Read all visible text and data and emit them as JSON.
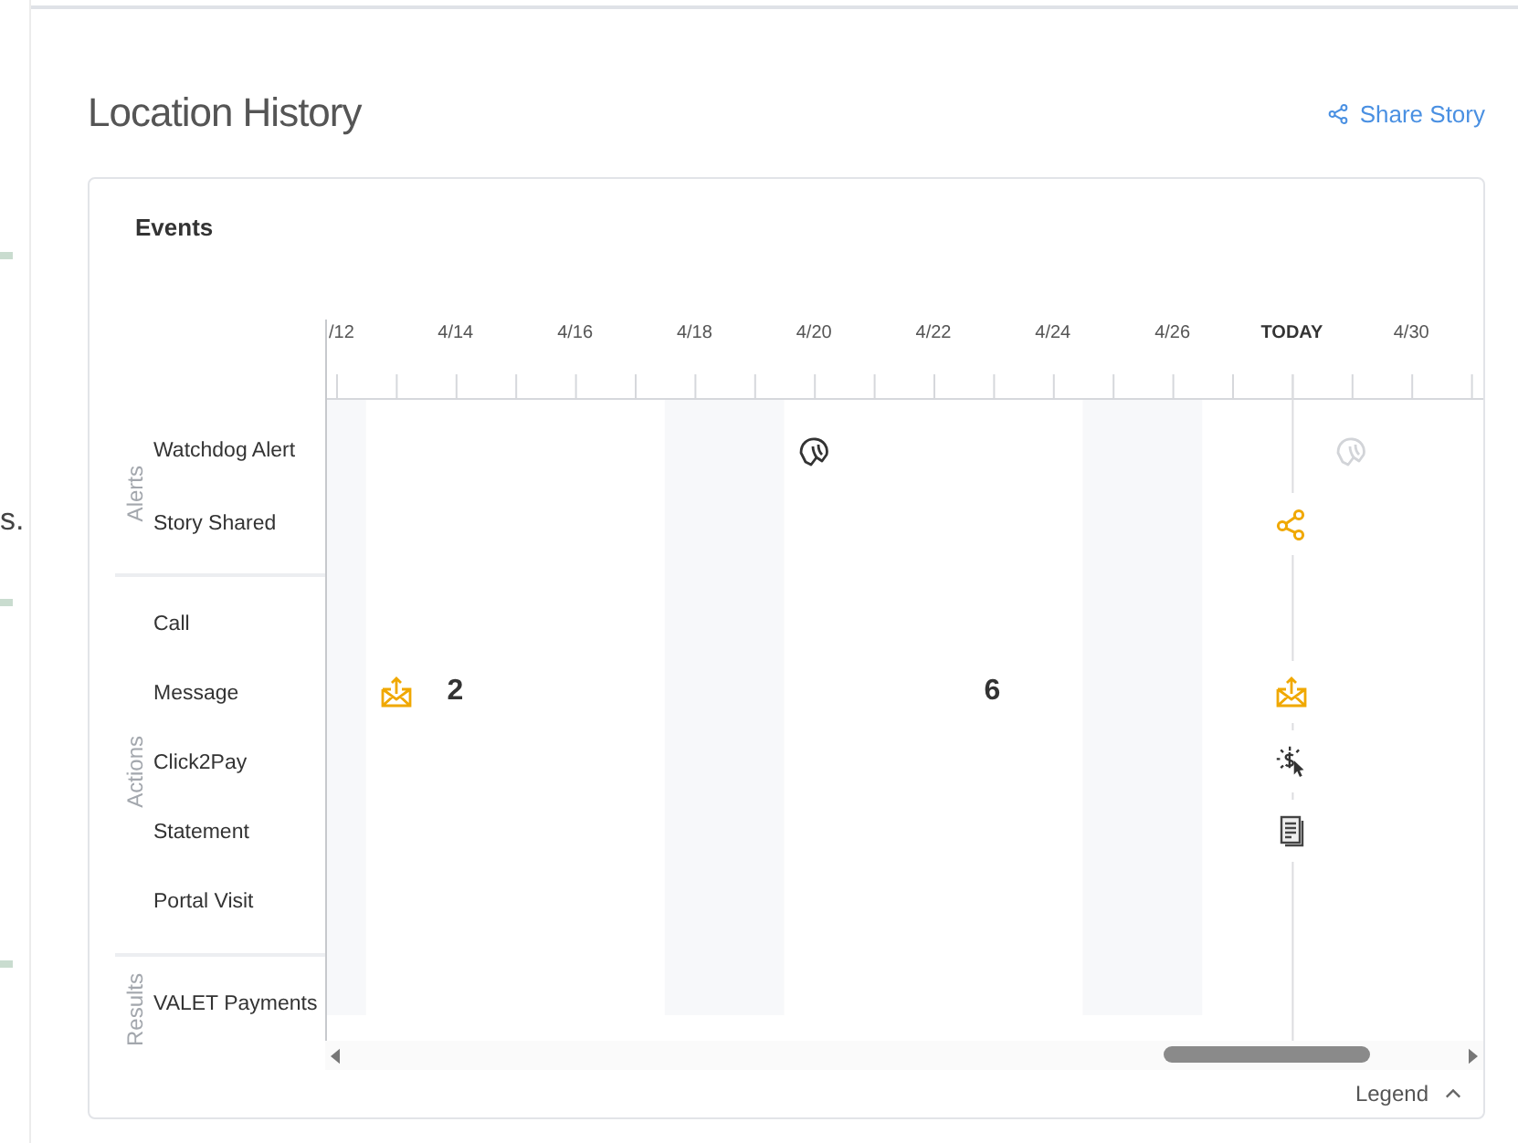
{
  "page_fragment": "s.",
  "header": {
    "title": "Location History",
    "share_link": "Share Story"
  },
  "events_panel": {
    "title": "Events",
    "axis": [
      {
        "label": "/12",
        "today": false
      },
      {
        "label": "4/14",
        "today": false
      },
      {
        "label": "4/16",
        "today": false
      },
      {
        "label": "4/18",
        "today": false
      },
      {
        "label": "4/20",
        "today": false
      },
      {
        "label": "4/22",
        "today": false
      },
      {
        "label": "4/24",
        "today": false
      },
      {
        "label": "4/26",
        "today": false
      },
      {
        "label": "TODAY",
        "today": true
      },
      {
        "label": "4/30",
        "today": false
      }
    ],
    "groups": [
      {
        "name": "Alerts",
        "rows": [
          {
            "label": "Watchdog Alert",
            "events": [
              {
                "kind": "watchdog",
                "faded": false
              },
              {
                "kind": "watchdog",
                "faded": true
              }
            ]
          },
          {
            "label": "Story Shared",
            "events": [
              {
                "kind": "share",
                "faded": false
              }
            ]
          }
        ]
      },
      {
        "name": "Actions",
        "rows": [
          {
            "label": "Call"
          },
          {
            "label": "Message",
            "events": [
              {
                "kind": "message",
                "count": "2",
                "faded": false
              },
              {
                "kind": "count",
                "count": "6",
                "faded": false
              },
              {
                "kind": "message",
                "faded": false
              }
            ]
          },
          {
            "label": "Click2Pay",
            "events": [
              {
                "kind": "click2pay",
                "faded": false
              }
            ]
          },
          {
            "label": "Statement",
            "events": [
              {
                "kind": "statement",
                "faded": false
              }
            ]
          },
          {
            "label": "Portal Visit"
          }
        ]
      },
      {
        "name": "Results",
        "rows": [
          {
            "label": "VALET Payments"
          }
        ]
      }
    ],
    "legend": "Legend"
  }
}
